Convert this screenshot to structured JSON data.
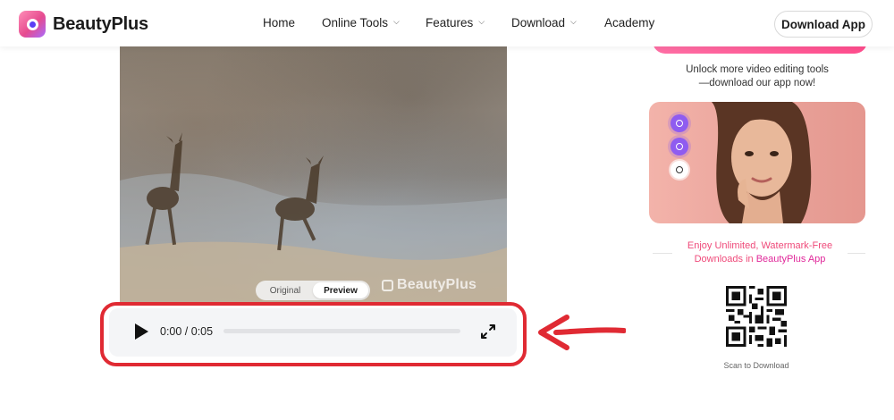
{
  "brand": {
    "name": "BeautyPlus"
  },
  "nav": {
    "home": "Home",
    "online_tools": "Online Tools",
    "features": "Features",
    "download": "Download",
    "academy": "Academy",
    "download_app": "Download App"
  },
  "video": {
    "toggle": {
      "original": "Original",
      "preview": "Preview",
      "active": "Preview"
    },
    "watermark": "BeautyPlus"
  },
  "player": {
    "time": "0:00 / 0:05",
    "progress": 0,
    "play_icon": "play-icon",
    "fullscreen_icon": "fullscreen-icon"
  },
  "annotation": {
    "highlight_color": "#e02a33"
  },
  "sidebar": {
    "unlock_line1": "Unlock more video editing tools",
    "unlock_line2": "—download our app now!",
    "enjoy_line1": "Enjoy Unlimited, Watermark-Free",
    "enjoy_line2_prefix": "Downloads in",
    "enjoy_line2_app": "BeautyPlus App",
    "scan_label": "Scan to Download"
  },
  "colors": {
    "accent_pink": "#ef4a7a",
    "accent_purple": "#8f5cf0"
  }
}
